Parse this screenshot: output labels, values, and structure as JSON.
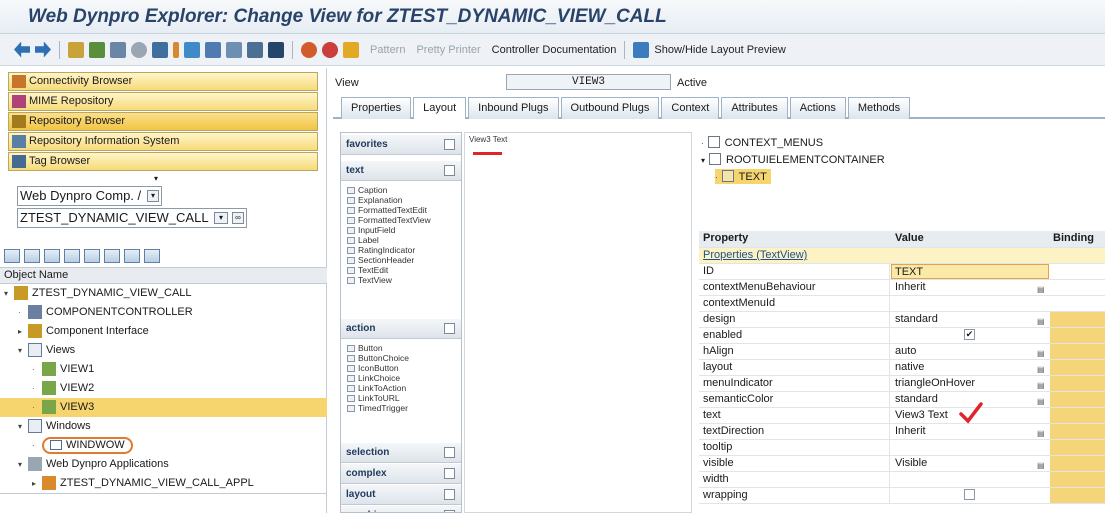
{
  "window": {
    "title": "Web Dynpro Explorer: Change View for ZTEST_DYNAMIC_VIEW_CALL"
  },
  "toolbar": {
    "pattern": "Pattern",
    "pretty_printer": "Pretty Printer",
    "controller_documentation": "Controller Documentation",
    "show_hide_layout_preview": "Show/Hide Layout Preview"
  },
  "left": {
    "repository_buttons": [
      "Connectivity Browser",
      "MIME Repository",
      "Repository Browser",
      "Repository Information System",
      "Tag Browser"
    ],
    "object_type": "Web Dynpro Comp. / Intf.",
    "object_name_value": "ZTEST_DYNAMIC_VIEW_CALL",
    "object_name_header": "Object Name",
    "tree": [
      "ZTEST_DYNAMIC_VIEW_CALL",
      "COMPONENTCONTROLLER",
      "Component Interface",
      "Views",
      "VIEW1",
      "VIEW2",
      "VIEW3",
      "Windows",
      "WINDWOW",
      "Web Dynpro Applications",
      "ZTEST_DYNAMIC_VIEW_CALL_APPL"
    ]
  },
  "view_header": {
    "label": "View",
    "value": "VIEW3",
    "status": "Active"
  },
  "tabs": [
    "Properties",
    "Layout",
    "Inbound Plugs",
    "Outbound Plugs",
    "Context",
    "Attributes",
    "Actions",
    "Methods"
  ],
  "palette": {
    "favorites": "favorites",
    "text": "text",
    "text_items": [
      "Caption",
      "Explanation",
      "FormattedTextEdit",
      "FormattedTextView",
      "InputField",
      "Label",
      "RatingIndicator",
      "SectionHeader",
      "TextEdit",
      "TextView"
    ],
    "action": "action",
    "action_items": [
      "Button",
      "ButtonChoice",
      "IconButton",
      "LinkChoice",
      "LinkToAction",
      "LinkToURL",
      "TimedTrigger"
    ],
    "selection": "selection",
    "complex": "complex",
    "layout": "layout",
    "graphic": "graphic"
  },
  "preview": {
    "text": "View3 Text"
  },
  "ui_tree": [
    "CONTEXT_MENUS",
    "ROOTUIELEMENTCONTAINER",
    "TEXT"
  ],
  "properties": {
    "col_property": "Property",
    "col_value": "Value",
    "col_binding": "Binding",
    "group": "Properties (TextView)",
    "rows": [
      {
        "name": "ID",
        "value": "TEXT"
      },
      {
        "name": "contextMenuBehaviour",
        "value": "Inherit"
      },
      {
        "name": "contextMenuId",
        "value": ""
      },
      {
        "name": "design",
        "value": "standard"
      },
      {
        "name": "enabled",
        "value": "✔"
      },
      {
        "name": "hAlign",
        "value": "auto"
      },
      {
        "name": "layout",
        "value": "native"
      },
      {
        "name": "menuIndicator",
        "value": "triangleOnHover"
      },
      {
        "name": "semanticColor",
        "value": "standard"
      },
      {
        "name": "text",
        "value": "View3 Text"
      },
      {
        "name": "textDirection",
        "value": "Inherit"
      },
      {
        "name": "tooltip",
        "value": ""
      },
      {
        "name": "visible",
        "value": "Visible"
      },
      {
        "name": "width",
        "value": ""
      },
      {
        "name": "wrapping",
        "value": ""
      }
    ]
  }
}
